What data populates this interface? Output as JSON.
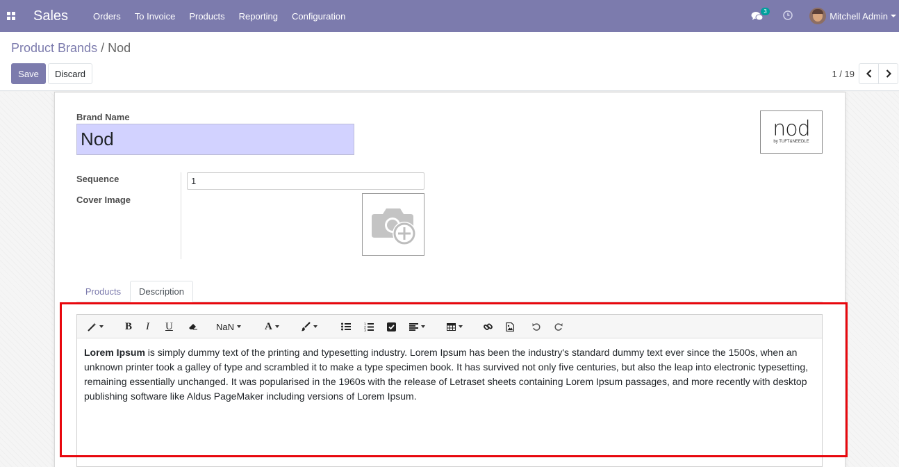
{
  "navbar": {
    "apps_icon": "grid-icon",
    "app_name": "Sales",
    "menu": [
      "Orders",
      "To Invoice",
      "Products",
      "Reporting",
      "Configuration"
    ],
    "chat_count": "3",
    "user_name": "Mitchell Admin",
    "bg_color": "#7c7bad"
  },
  "control_panel": {
    "breadcrumb_parent": "Product Brands",
    "breadcrumb_sep": "/",
    "breadcrumb_current": "Nod",
    "save_label": "Save",
    "discard_label": "Discard",
    "pager": "1 / 19"
  },
  "form": {
    "brand_name_label": "Brand Name",
    "brand_name_value": "Nod",
    "logo_text": "nod",
    "logo_subtext": "by TUFT&NEEDLE",
    "sequence_label": "Sequence",
    "sequence_value": "1",
    "cover_image_label": "Cover Image"
  },
  "tabs": [
    "Products",
    "Description"
  ],
  "active_tab": "Description",
  "editor": {
    "font_size_label": "NaN",
    "font_color_label": "A",
    "bold_label": "B",
    "italic_label": "I",
    "underline_label": "U",
    "content_bold": "Lorem Ipsum",
    "content_rest": " is simply dummy text of the printing and typesetting industry. Lorem Ipsum has been the industry's standard dummy text ever since the 1500s, when an unknown printer took a galley of type and scrambled it to make a type specimen book. It has survived not only five centuries, but also the leap into electronic typesetting, remaining essentially unchanged. It was popularised in the 1960s with the release of Letraset sheets containing Lorem Ipsum passages, and more recently with desktop publishing software like Aldus PageMaker including versions of Lorem Ipsum."
  },
  "highlight_color": "#e8070d"
}
